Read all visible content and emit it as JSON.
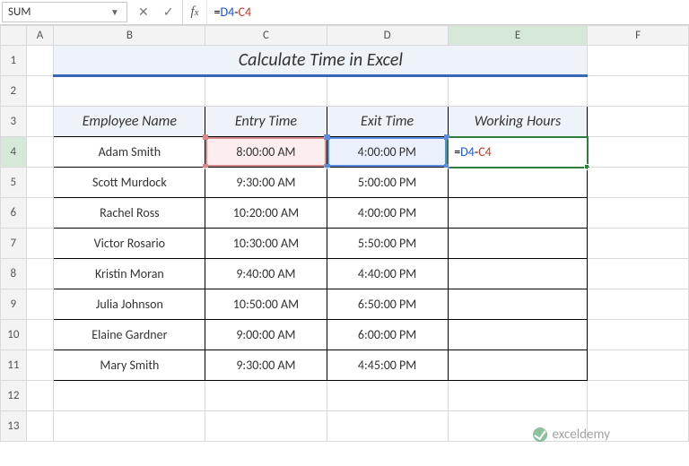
{
  "name_box": "SUM",
  "formula_bar": {
    "eq": "=",
    "ref1": "D4",
    "minus": "-",
    "ref2": "C4"
  },
  "col_headers": [
    "A",
    "B",
    "C",
    "D",
    "E",
    "F"
  ],
  "row_headers": [
    "1",
    "2",
    "3",
    "4",
    "5",
    "6",
    "7",
    "8",
    "9",
    "10",
    "11",
    "12",
    "13"
  ],
  "active_col_index": 4,
  "active_row_index": 3,
  "title": "Calculate Time in Excel",
  "headers": {
    "B": "Employee Name",
    "C": "Entry Time",
    "D": "Exit Time",
    "E": "Working Hours"
  },
  "rows": [
    {
      "name": "Adam Smith",
      "entry": "8:00:00 AM",
      "exit": "4:00:00 PM"
    },
    {
      "name": "Scott Murdock",
      "entry": "9:30:00 AM",
      "exit": "5:00:00 PM"
    },
    {
      "name": "Rachel Ross",
      "entry": "10:20:00 AM",
      "exit": "4:00:00 PM"
    },
    {
      "name": "Victor Rosario",
      "entry": "10:30:00 AM",
      "exit": "5:50:00 PM"
    },
    {
      "name": "Kristin Moran",
      "entry": "9:40:00 AM",
      "exit": "4:40:00 PM"
    },
    {
      "name": "Julia Johnson",
      "entry": "10:50:00 AM",
      "exit": "6:50:00 PM"
    },
    {
      "name": "Elaine Gardner",
      "entry": "9:00:00 AM",
      "exit": "6:00:00 PM"
    },
    {
      "name": "Mary Smith",
      "entry": "9:30:00 AM",
      "exit": "4:45:00 PM"
    }
  ],
  "editing_formula": {
    "eq": "=",
    "ref1": "D4",
    "minus": "-",
    "ref2": "C4"
  },
  "watermark": "exceldemy"
}
